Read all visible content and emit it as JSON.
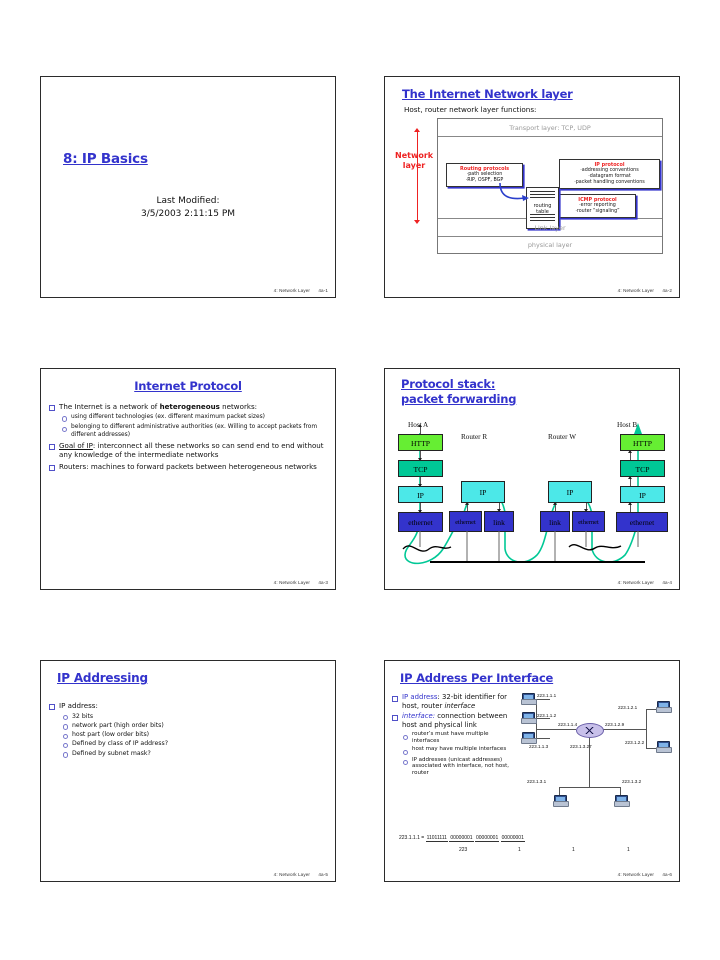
{
  "footer": {
    "course": "4: Network Layer"
  },
  "slides": [
    {
      "id": "slide-1",
      "title": "8: IP Basics",
      "last_modified_label": "Last Modified:",
      "last_modified_value": "3/5/2003 2:11:15 PM",
      "page_num": "4a-1"
    },
    {
      "id": "slide-2",
      "title": "The Internet Network layer",
      "subtitle": "Host, router network layer functions:",
      "side_label": "Network\nlayer",
      "layers": {
        "transport": "Transport layer: TCP, UDP",
        "link": "Link layer",
        "physical": "physical layer"
      },
      "routing_protocols": {
        "head": "Routing protocols",
        "lines": [
          "·path selection",
          "·RIP, OSPF, BGP"
        ]
      },
      "ip_protocol": {
        "head": "IP protocol",
        "lines": [
          "·addressing conventions",
          "·datagram format",
          "·packet handling conventions"
        ]
      },
      "icmp_protocol": {
        "head": "ICMP protocol",
        "lines": [
          "·error reporting",
          "·router “signaling”"
        ]
      },
      "routing_table": "routing\ntable",
      "page_num": "4a-2"
    },
    {
      "id": "slide-3",
      "title": "Internet Protocol",
      "bullets": [
        {
          "level": 1,
          "text": "The Internet is a network of heterogeneous networks:"
        },
        {
          "level": 2,
          "text": "using different technologies (ex. different maximum packet sizes)"
        },
        {
          "level": 2,
          "text": "belonging to different administrative authorities (ex. Willing to accept packets from different addresses)"
        },
        {
          "level": 1,
          "text": "Goal of IP: interconnect all these networks so can send end to end without any knowledge of the intermediate networks"
        },
        {
          "level": 1,
          "text": "Routers: machines to forward packets between heterogeneous networks"
        }
      ],
      "page_num": "4a-3"
    },
    {
      "id": "slide-4",
      "title": "Protocol stack:\npacket forwarding",
      "node_labels": [
        "Host A",
        "Router R",
        "Router W",
        "Host B"
      ],
      "host_a_stack": [
        "HTTP",
        "TCP",
        "IP",
        "ethernet"
      ],
      "router_r_stack": {
        "upper": "IP",
        "left": "ethernet",
        "right": "link"
      },
      "router_w_stack": {
        "upper": "IP",
        "left": "link",
        "right": "ethernet"
      },
      "host_b_stack": [
        "HTTP",
        "TCP",
        "IP",
        "ethernet"
      ],
      "colors": {
        "http": "#66ee33",
        "tcp": "#00c896",
        "ip": "#4ce8e8",
        "ethernet": "#3333cc",
        "packet_path": "#00c896"
      },
      "page_num": "4a-4"
    },
    {
      "id": "slide-5",
      "title": "IP Addressing",
      "bullets": [
        {
          "level": 1,
          "text": "IP address:"
        },
        {
          "level": 2,
          "text": "32 bits"
        },
        {
          "level": 2,
          "text": "network part (high order bits)"
        },
        {
          "level": 2,
          "text": "host part (low order bits)"
        },
        {
          "level": 2,
          "text": "Defined by class of IP address?"
        },
        {
          "level": 2,
          "text": "Defined by subnet mask?"
        }
      ],
      "page_num": "4a-5"
    },
    {
      "id": "slide-6",
      "title": "IP Address Per Interface",
      "bullets": [
        {
          "level": 1,
          "text": "IP address: 32-bit identifier for host, router interface"
        },
        {
          "level": 1,
          "text": "interface: connection between host and physical link"
        },
        {
          "level": 2,
          "text": "router’s must have multiple interfaces"
        },
        {
          "level": 2,
          "text": "host may have multiple interfaces"
        },
        {
          "level": 2,
          "text": "IP addresses (unicast addresses) associated with interface, not host, router"
        }
      ],
      "network_addresses": [
        "223.1.1.1",
        "223.1.1.2",
        "223.1.1.3",
        "223.1.1.4",
        "223.1.2.9",
        "223.1.2.1",
        "223.1.2.2",
        "223.1.3.27",
        "223.1.3.1",
        "223.1.3.2"
      ],
      "binary": {
        "prefix": "223.1.1.1 =",
        "octets": [
          "11011111",
          "00000001",
          "00000001",
          "00000001"
        ],
        "decimals": [
          "223",
          "1",
          "1",
          "1"
        ]
      },
      "page_num": "4a-6"
    }
  ]
}
